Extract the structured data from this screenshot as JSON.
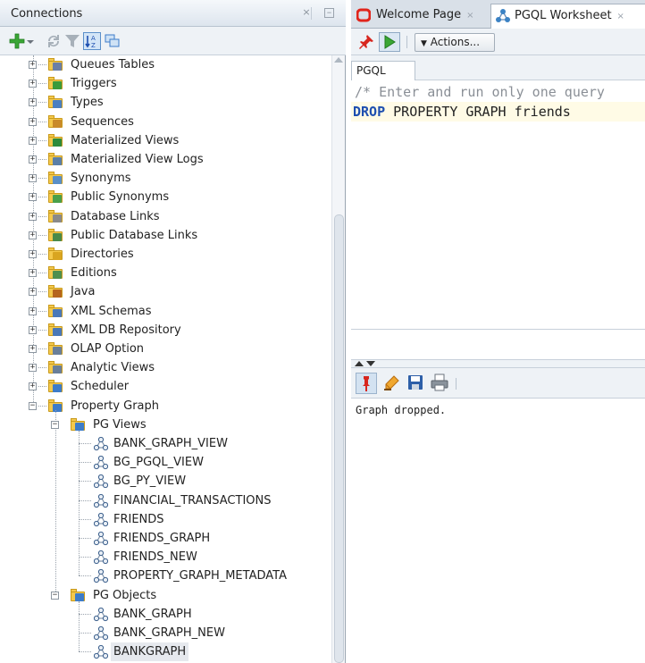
{
  "connections": {
    "title": "Connections",
    "tree": [
      {
        "label": "Queues Tables",
        "icon": "queue-tables-icon",
        "color": "#6b7fa6"
      },
      {
        "label": "Triggers",
        "icon": "triggers-icon",
        "color": "#3b9b3b"
      },
      {
        "label": "Types",
        "icon": "types-icon",
        "color": "#4a7fc1"
      },
      {
        "label": "Sequences",
        "icon": "sequences-icon",
        "color": "#c98a2a"
      },
      {
        "label": "Materialized Views",
        "icon": "materialized-views-icon",
        "color": "#2e8b3a"
      },
      {
        "label": "Materialized View Logs",
        "icon": "materialized-view-logs-icon",
        "color": "#5b7fa8"
      },
      {
        "label": "Synonyms",
        "icon": "synonyms-icon",
        "color": "#5a8fc7"
      },
      {
        "label": "Public Synonyms",
        "icon": "public-synonyms-icon",
        "color": "#4aa04a"
      },
      {
        "label": "Database Links",
        "icon": "database-links-icon",
        "color": "#8a8a8a"
      },
      {
        "label": "Public Database Links",
        "icon": "public-database-links-icon",
        "color": "#4a8a4a"
      },
      {
        "label": "Directories",
        "icon": "directories-icon",
        "color": "#d9a520"
      },
      {
        "label": "Editions",
        "icon": "editions-icon",
        "color": "#4e8f4e"
      },
      {
        "label": "Java",
        "icon": "java-icon",
        "color": "#b5651d"
      },
      {
        "label": "XML Schemas",
        "icon": "xml-schemas-icon",
        "color": "#4a78b8"
      },
      {
        "label": "XML DB Repository",
        "icon": "xml-db-repository-icon",
        "color": "#4a78b8"
      },
      {
        "label": "OLAP Option",
        "icon": "olap-option-icon",
        "color": "#6a7f99"
      },
      {
        "label": "Analytic Views",
        "icon": "analytic-views-icon",
        "color": "#6a7f99"
      },
      {
        "label": "Scheduler",
        "icon": "scheduler-icon",
        "color": "#3d7cc9"
      },
      {
        "label": "Property Graph",
        "icon": "property-graph-icon",
        "color": "#3d7cc9"
      }
    ],
    "pg_views": {
      "label": "PG Views",
      "items": [
        "BANK_GRAPH_VIEW",
        "BG_PGQL_VIEW",
        "BG_PY_VIEW",
        "FINANCIAL_TRANSACTIONS",
        "FRIENDS",
        "FRIENDS_GRAPH",
        "FRIENDS_NEW",
        "PROPERTY_GRAPH_METADATA"
      ]
    },
    "pg_objects": {
      "label": "PG Objects",
      "items": [
        "BANK_GRAPH",
        "BANK_GRAPH_NEW",
        "BANKGRAPH"
      ],
      "selected": "BANKGRAPH"
    }
  },
  "worksheet": {
    "tabs": [
      {
        "label": "Welcome Page",
        "icon": "oracle-icon"
      },
      {
        "label": "PGQL Worksheet",
        "icon": "graph-icon"
      }
    ],
    "actions_label": "Actions...",
    "editor_tab": "PGQL",
    "editor_lines": {
      "comment": "/* Enter and run only one query",
      "keyword": "DROP",
      "rest": " PROPERTY GRAPH friends"
    },
    "output_text": "Graph dropped."
  },
  "colors": {
    "accent": "#3b8ee6",
    "keyword": "#1e4fb0",
    "folder": "#f4c94c",
    "run_green": "#3aa635",
    "oracle_red": "#e1251b"
  }
}
